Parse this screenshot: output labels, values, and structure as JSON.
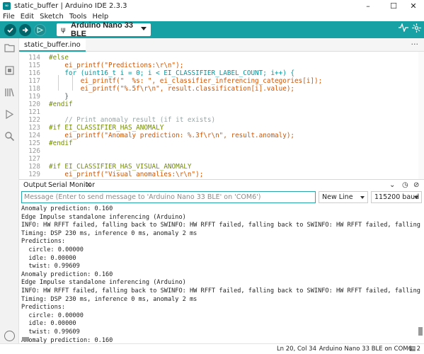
{
  "window": {
    "title": "static_buffer | Arduino IDE 2.3.3",
    "app_icon": "arduino-icon",
    "minimize": "–",
    "maximize": "☐",
    "close": "✕"
  },
  "menu": [
    "File",
    "Edit",
    "Sketch",
    "Tools",
    "Help"
  ],
  "toolbar": {
    "board": "Arduino Nano 33 BLE",
    "accent_color": "#17a1a5",
    "icons": [
      "verify-icon",
      "upload-icon",
      "debug-icon",
      "usb-icon",
      "serial-plotter-icon",
      "serial-monitor-icon"
    ]
  },
  "sidebar": {
    "icons": [
      "sketchbook-icon",
      "boards-manager-icon",
      "library-manager-icon",
      "debug-icon",
      "search-icon",
      "account-icon"
    ]
  },
  "tab": {
    "filename": "static_buffer.ino",
    "more": "···"
  },
  "editor": {
    "lines": [
      {
        "n": "114",
        "text": "#else"
      },
      {
        "n": "115",
        "text": "    ei_printf(\"Predictions:\\r\\n\");"
      },
      {
        "n": "116",
        "text": "    for (uint16_t i = 0; i < EI_CLASSIFIER_LABEL_COUNT; i++) {"
      },
      {
        "n": "117",
        "text": "        ei_printf(\"  %s: \", ei_classifier_inferencing_categories[i]);"
      },
      {
        "n": "118",
        "text": "        ei_printf(\"%.5f\\r\\n\", result.classification[i].value);"
      },
      {
        "n": "119",
        "text": "    }"
      },
      {
        "n": "120",
        "text": "#endif"
      },
      {
        "n": "121",
        "text": ""
      },
      {
        "n": "122",
        "text": "    // Print anomaly result (if it exists)"
      },
      {
        "n": "123",
        "text": "#if EI_CLASSIFIER_HAS_ANOMALY"
      },
      {
        "n": "124",
        "text": "    ei_printf(\"Anomaly prediction: %.3f\\r\\n\", result.anomaly);"
      },
      {
        "n": "125",
        "text": "#endif"
      },
      {
        "n": "126",
        "text": ""
      },
      {
        "n": "127",
        "text": ""
      },
      {
        "n": "128",
        "text": "#if EI_CLASSIFIER_HAS_VISUAL_ANOMALY"
      },
      {
        "n": "129",
        "text": "    ei_printf(\"Visual anomalies:\\r\\n\");"
      }
    ]
  },
  "panel": {
    "tabs": [
      "Output",
      "Serial Monitor"
    ],
    "close": "✕",
    "input_placeholder": "Message (Enter to send message to 'Arduino Nano 33 BLE' on 'COM6')",
    "line_ending": "New Line",
    "baud": "115200 baud",
    "output": [
      "Anomaly prediction: 0.160",
      "Edge Impulse standalone inferencing (Arduino)",
      "INFO: HW RFFT failed, falling back to SWINFO: HW RFFT failed, falling back to SWINFO: HW RFFT failed, falling back to SW",
      "Timing: DSP 230 ms, inference 0 ms, anomaly 2 ms",
      "Predictions:",
      "  circle: 0.00000",
      "  idle: 0.00000",
      "  twist: 0.99609",
      "Anomaly prediction: 0.160",
      "Edge Impulse standalone inferencing (Arduino)",
      "INFO: HW RFFT failed, falling back to SWINFO: HW RFFT failed, falling back to SWINFO: HW RFFT failed, falling back to SW",
      "Timing: DSP 230 ms, inference 0 ms, anomaly 2 ms",
      "Predictions:",
      "  circle: 0.00000",
      "  idle: 0.00000",
      "  twist: 0.99609",
      "Anomaly prediction: 0.160"
    ]
  },
  "status": {
    "position": "Ln 20, Col 34",
    "board": "Arduino Nano 33 BLE on COM6",
    "notifications": "2"
  }
}
